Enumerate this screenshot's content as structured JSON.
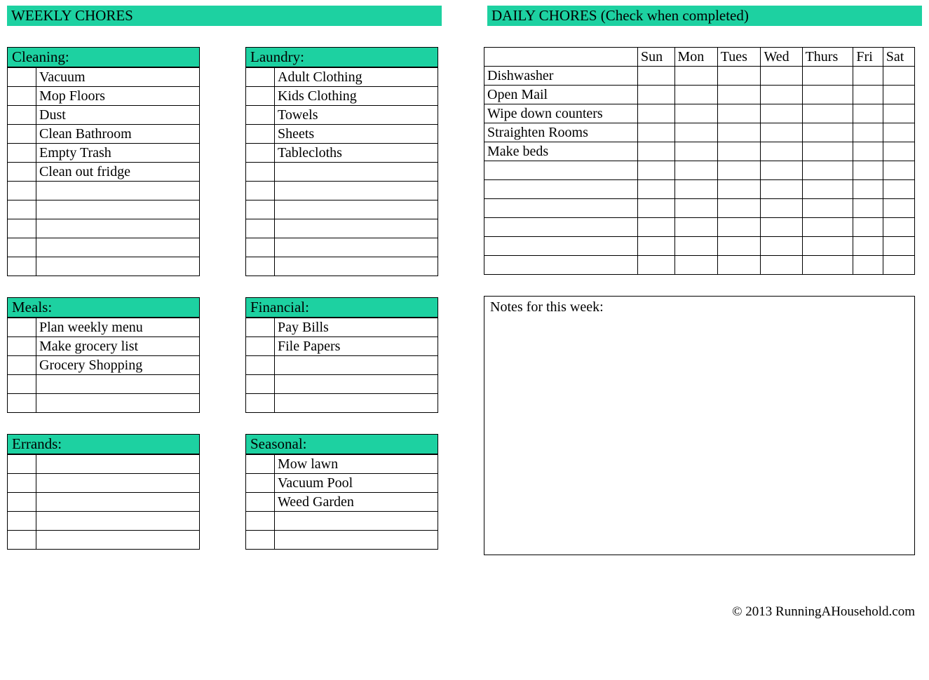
{
  "headers": {
    "weekly": "WEEKLY CHORES",
    "daily": "DAILY CHORES (Check when completed)"
  },
  "categories": {
    "cleaning": {
      "title": "Cleaning:",
      "items": [
        "Vacuum",
        "Mop Floors",
        "Dust",
        "Clean Bathroom",
        "Empty Trash",
        "Clean out fridge",
        "",
        "",
        "",
        "",
        ""
      ]
    },
    "laundry": {
      "title": "Laundry:",
      "items": [
        "Adult Clothing",
        "Kids Clothing",
        "Towels",
        "Sheets",
        "Tablecloths",
        "",
        "",
        "",
        "",
        "",
        ""
      ]
    },
    "meals": {
      "title": "Meals:",
      "items": [
        "Plan weekly menu",
        "Make grocery list",
        "Grocery Shopping",
        "",
        ""
      ]
    },
    "financial": {
      "title": "Financial:",
      "items": [
        "Pay Bills",
        "File Papers",
        "",
        "",
        ""
      ]
    },
    "errands": {
      "title": "Errands:",
      "items": [
        "",
        "",
        "",
        "",
        ""
      ]
    },
    "seasonal": {
      "title": "Seasonal:",
      "items": [
        "Mow lawn",
        "Vacuum Pool",
        "Weed Garden",
        "",
        ""
      ]
    }
  },
  "daily": {
    "days": [
      "Sun",
      "Mon",
      "Tues",
      "Wed",
      "Thurs",
      "Fri",
      "Sat"
    ],
    "tasks": [
      "Dishwasher",
      "Open Mail",
      "Wipe down counters",
      "Straighten Rooms",
      "Make beds",
      "",
      "",
      "",
      "",
      "",
      ""
    ]
  },
  "notes_label": "Notes for this week:",
  "footer": "© 2013 RunningAHousehold.com"
}
